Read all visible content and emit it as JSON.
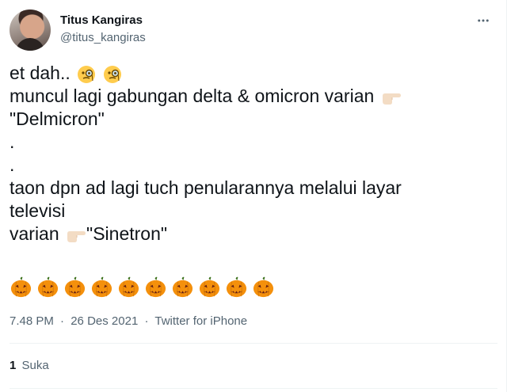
{
  "author": {
    "name": "Titus Kangiras",
    "handle": "@titus_kangiras"
  },
  "tweet": {
    "lines": [
      "et dah..",
      "muncul lagi gabungan delta & omicron varian",
      "\"Delmicron\"",
      ".",
      ".",
      "taon dpn ad lagi tuch penularannya melalui layar",
      "televisi",
      "varian ",
      "\"Sinetron\""
    ],
    "emoji": {
      "line1": [
        "monocle-face",
        "monocle-face"
      ],
      "line2": [
        "pointing-right-hand"
      ],
      "line8": [
        "pointing-right-hand"
      ],
      "pumpkin_row": [
        "jack-o-lantern",
        "jack-o-lantern",
        "jack-o-lantern",
        "jack-o-lantern",
        "jack-o-lantern",
        "jack-o-lantern",
        "jack-o-lantern",
        "jack-o-lantern",
        "jack-o-lantern",
        "jack-o-lantern"
      ]
    }
  },
  "meta": {
    "time": "7.48 PM",
    "date": "26 Des 2021",
    "separator": "·",
    "source": "Twitter for iPhone"
  },
  "stats": {
    "likes_count": "1",
    "likes_label": "Suka"
  },
  "icons": {
    "more": "more-horizontal-icon"
  }
}
